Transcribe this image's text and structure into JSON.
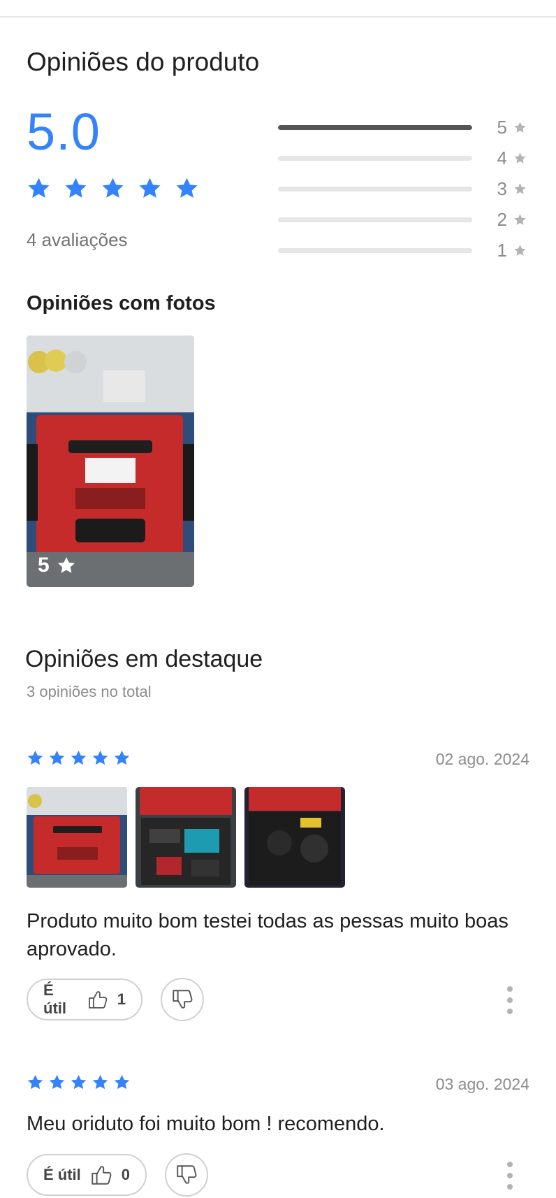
{
  "header": {
    "title": "Opiniões do produto"
  },
  "summary": {
    "average": "5.0",
    "stars_filled": 5,
    "review_count_text": "4 avaliações",
    "accent_color": "#3483fa"
  },
  "distribution": [
    {
      "stars": "5",
      "fraction": 1.0
    },
    {
      "stars": "4",
      "fraction": 0.0
    },
    {
      "stars": "3",
      "fraction": 0.0
    },
    {
      "stars": "2",
      "fraction": 0.0
    },
    {
      "stars": "1",
      "fraction": 0.0
    }
  ],
  "photos_section": {
    "title": "Opiniões com fotos",
    "photo_badge": "5"
  },
  "featured": {
    "title": "Opiniões em destaque",
    "subtitle": "3 opiniões no total"
  },
  "reviews": [
    {
      "stars": 5,
      "date": "02 ago. 2024",
      "text": "Produto muito bom testei todas as pessas muito boas aprovado.",
      "helpful_label": "É útil",
      "helpful_count": "1",
      "thumbnails": 3
    },
    {
      "stars": 5,
      "date": "03 ago. 2024",
      "text": "Meu oriduto foi muito bom ! recomendo.",
      "helpful_label": "É útil",
      "helpful_count": "0",
      "thumbnails": 0
    }
  ],
  "icons": {
    "star": "star-icon",
    "thumb_up": "thumbs-up-icon",
    "thumb_down": "thumbs-down-icon",
    "more": "more-vertical-icon"
  }
}
